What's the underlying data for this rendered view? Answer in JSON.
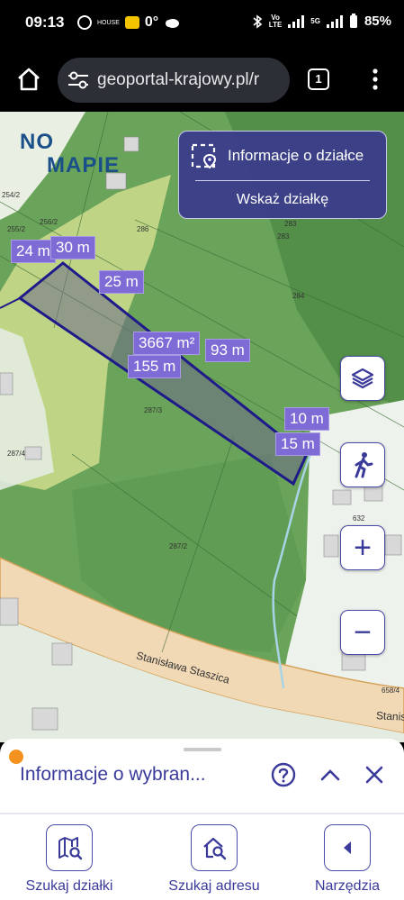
{
  "status_bar": {
    "time": "09:13",
    "temperature": "0°",
    "network_top": "Vo",
    "network_bottom": "LTE",
    "network_5g": "5G",
    "battery": "85%",
    "small_label": "HOUSE"
  },
  "browser": {
    "url": "geoportal-krajowy.pl/r",
    "tab_count": "1"
  },
  "map": {
    "logo_left": "NO",
    "logo_right": "MAPIE",
    "info_panel": {
      "title": "Informacje o działce",
      "action": "Wskaż działkę"
    },
    "measurements": {
      "left_24": "24 m",
      "left_30": "30 m",
      "top_25": "25 m",
      "area": "3667 m²",
      "bottom_155": "155 m",
      "side_93": "93 m",
      "right_10": "10 m",
      "right_15": "15 m"
    },
    "parcel_numbers": [
      "254/2",
      "256/2",
      "255/2",
      "286",
      "283",
      "283",
      "284",
      "287/3",
      "287/4",
      "287/2",
      "632",
      "658/4"
    ],
    "street_name": "Stanisława Staszica",
    "street_name_right": "Stanis",
    "colors": {
      "parcel_outline": "#1f1a8a",
      "label_bg": "#7f6bd6",
      "panel_bg": "#3a3a8c"
    }
  },
  "controls": {
    "layers_icon": "layers-icon",
    "walk_icon": "walking-person-icon",
    "zoom_in": "+",
    "zoom_out": "−"
  },
  "sheet": {
    "title": "Informacje o wybran..."
  },
  "bottom_nav": [
    {
      "label": "Szukaj działki",
      "icon": "map-search-icon"
    },
    {
      "label": "Szukaj adresu",
      "icon": "home-search-icon"
    },
    {
      "label": "Narzędzia",
      "icon": "tools-icon"
    }
  ]
}
